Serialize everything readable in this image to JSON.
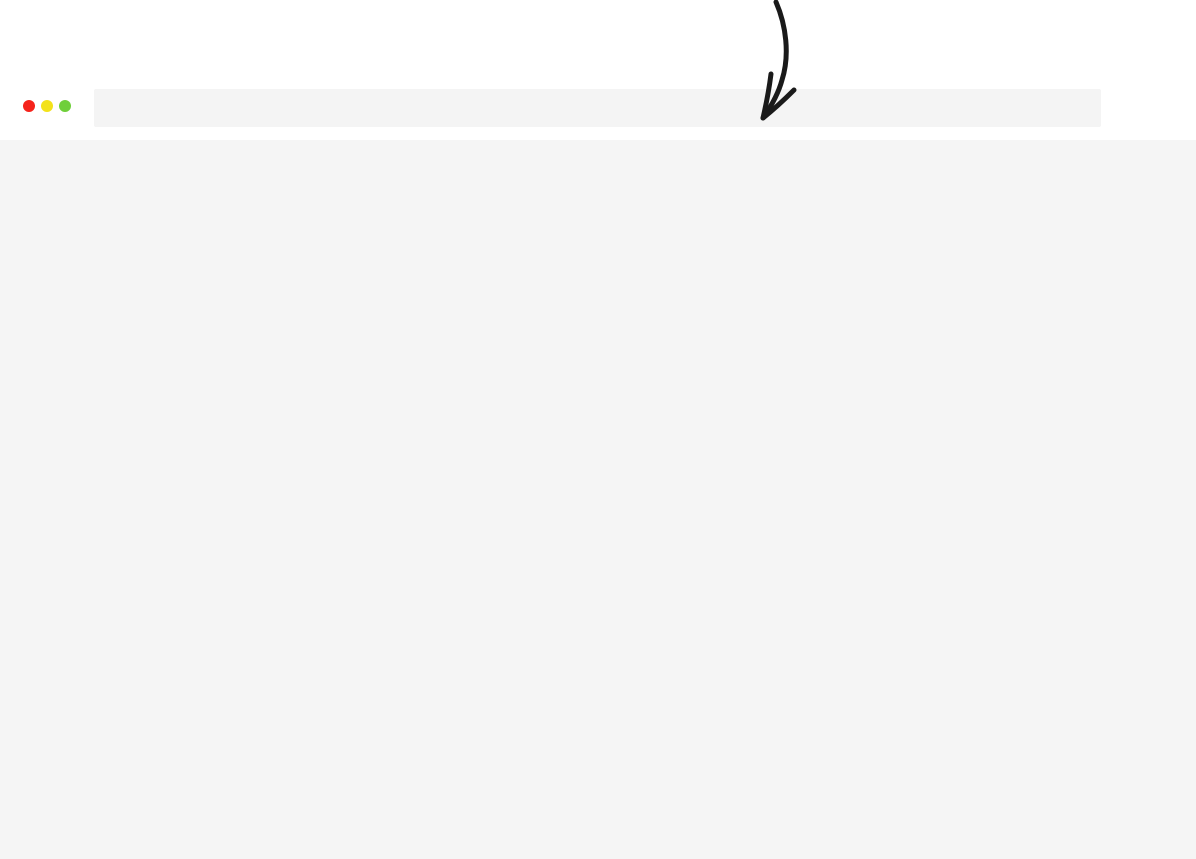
{
  "browser": {
    "address_bar": {
      "value": "",
      "placeholder": ""
    },
    "window_controls": [
      {
        "name": "close",
        "color": "#f5231b"
      },
      {
        "name": "minimize",
        "color": "#f3e21a"
      },
      {
        "name": "maximize",
        "color": "#6fcf3a"
      }
    ]
  },
  "annotation": {
    "icon": "hand-drawn-arrow-icon",
    "color": "#1a1a1a"
  },
  "colors": {
    "page_background": "#ffffff",
    "content_background": "#f5f5f5",
    "address_bar_background": "#f4f4f4"
  }
}
